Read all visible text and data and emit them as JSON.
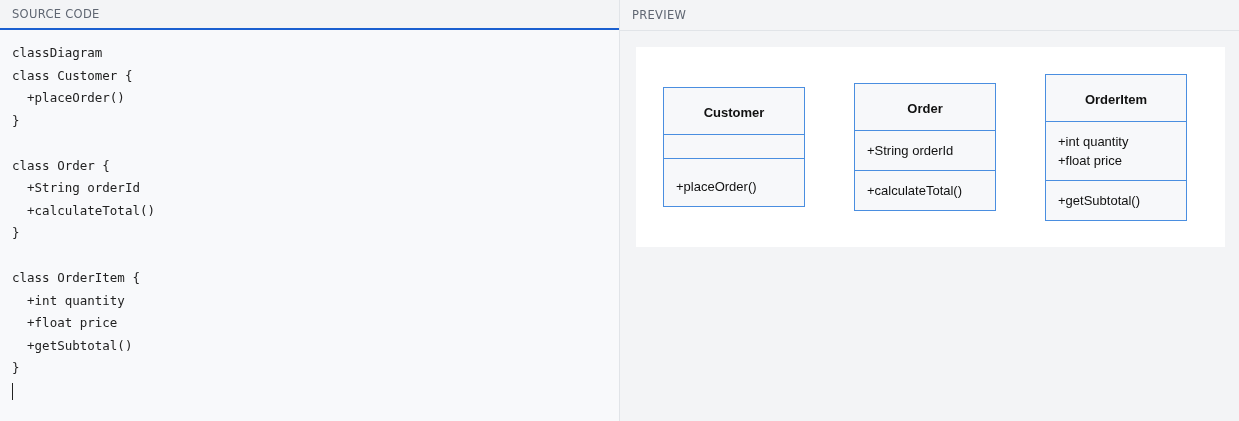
{
  "panes": [
    {
      "title": "SOURCE CODE",
      "selected": true
    },
    {
      "title": "PREVIEW",
      "selected": false
    }
  ],
  "source_code": "classDiagram\nclass Customer {\n  +placeOrder()\n}\n\nclass Order {\n  +String orderId\n  +calculateTotal()\n}\n\nclass OrderItem {\n  +int quantity\n  +float price\n  +getSubtotal()\n}",
  "diagram": {
    "classes": [
      {
        "name": "Customer",
        "methods": [
          "+placeOrder()"
        ]
      },
      {
        "name": "Order",
        "attributes": [
          "+String orderId"
        ],
        "methods": [
          "+calculateTotal()"
        ]
      },
      {
        "name": "OrderItem",
        "attributes": [
          "+int quantity",
          "+float price"
        ],
        "methods": [
          "+getSubtotal()"
        ]
      }
    ]
  }
}
